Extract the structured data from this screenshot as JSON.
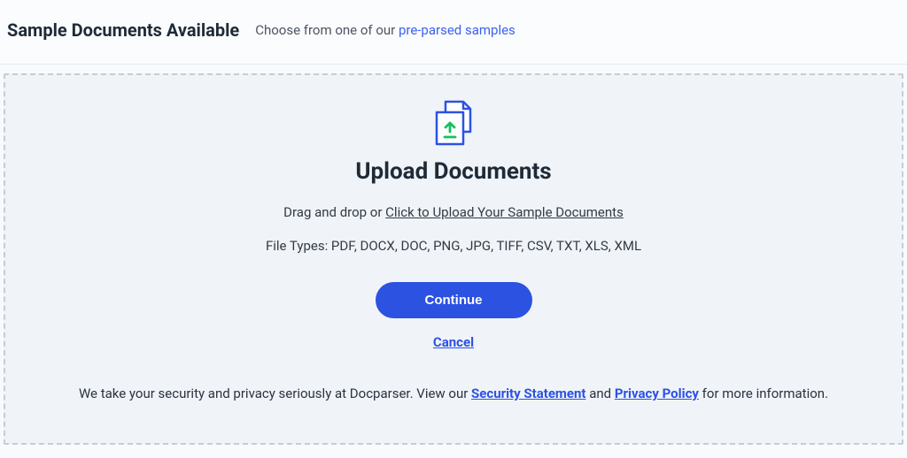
{
  "topbar": {
    "title": "Sample Documents Available",
    "sub_prefix": "Choose from one of our ",
    "link_text": "pre-parsed samples"
  },
  "upload": {
    "title": "Upload Documents",
    "drag_prefix": "Drag and drop or ",
    "click_text": "Click to Upload Your Sample Documents",
    "filetypes": "File Types: PDF, DOCX, DOC, PNG, JPG, TIFF, CSV, TXT, XLS, XML"
  },
  "buttons": {
    "continue": "Continue",
    "cancel": "Cancel"
  },
  "footer": {
    "prefix": "We take your security and privacy seriously at Docparser. View our ",
    "security_link": "Security Statement",
    "mid": " and ",
    "privacy_link": "Privacy Policy",
    "suffix": " for more information."
  }
}
